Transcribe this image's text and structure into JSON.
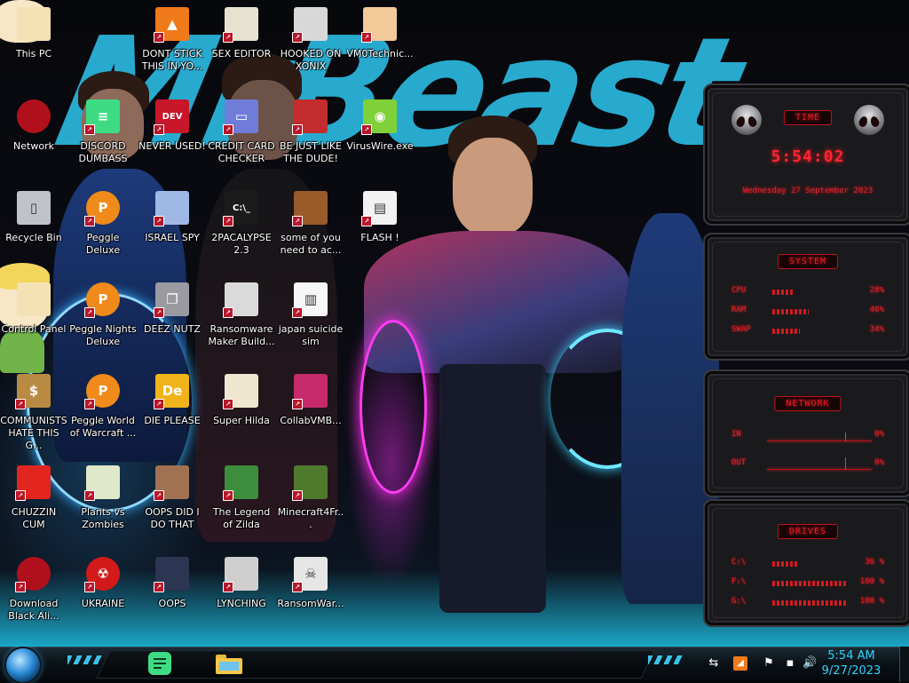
{
  "wallpaper": {
    "title_text": "MrBeast"
  },
  "desktop_icons": [
    {
      "label": "This PC",
      "icon": "star-vs-forces-icon"
    },
    {
      "label": "DONT STICK THIS IN YO...",
      "icon": "vlc-cone-icon"
    },
    {
      "label": "SEX EDITOR",
      "icon": "hex-editor-icon"
    },
    {
      "label": "HOOKED ON XONIX",
      "icon": "xonix-game-icon"
    },
    {
      "label": "VM0Technic...",
      "icon": "doctor-icon"
    },
    {
      "label": "Network",
      "icon": "red-orb-icon"
    },
    {
      "label": "DISCORD DUMBASS",
      "icon": "chat-app-icon"
    },
    {
      "label": "NEVER USED!",
      "icon": "devcpp-icon"
    },
    {
      "label": "CREDIT CARD CHECKER",
      "icon": "credit-card-icon"
    },
    {
      "label": "BE JUST LIKE THE DUDE!",
      "icon": "santa-icon"
    },
    {
      "label": "VirusWire.exe",
      "icon": "lime-icon"
    },
    {
      "label": "Recycle Bin",
      "icon": "trash-can-icon"
    },
    {
      "label": "Peggle Deluxe",
      "icon": "peggle-icon"
    },
    {
      "label": "ISRAEL SPY",
      "icon": "network-cable-icon"
    },
    {
      "label": "2PACALYPSE 2.3",
      "icon": "terminal-icon"
    },
    {
      "label": "some of you need to ac...",
      "icon": "beaver-icon"
    },
    {
      "label": "FLASH !",
      "icon": "document-icon"
    },
    {
      "label": "Control Panel",
      "icon": "star-vs-forces-icon"
    },
    {
      "label": "Peggle Nights Deluxe",
      "icon": "peggle-icon"
    },
    {
      "label": "DEEZ NUTZ",
      "icon": "windows-stack-icon"
    },
    {
      "label": "Ransomware Maker Build...",
      "icon": "window-app-icon"
    },
    {
      "label": "japan suicide sim",
      "icon": "file-icon"
    },
    {
      "label": "COMMUNISTS HATE THIS G...",
      "icon": "money-bag-icon"
    },
    {
      "label": "Peggle World of Warcraft ...",
      "icon": "peggle-icon"
    },
    {
      "label": "DIE PLEASE",
      "icon": "de-icon"
    },
    {
      "label": "Super Hilda",
      "icon": "pixel-game-icon"
    },
    {
      "label": "CollabVMB...",
      "icon": "pc-monitor-icon"
    },
    {
      "label": "CHUZZIN CUM",
      "icon": "chuzzle-icon"
    },
    {
      "label": "Plants vs Zombies",
      "icon": "pvz-icon"
    },
    {
      "label": "OOPS DID I DO THAT",
      "icon": "portrait-icon"
    },
    {
      "label": "The Legend of Zilda",
      "icon": "link-sprite-icon"
    },
    {
      "label": "Minecraft4Fr...",
      "icon": "grass-block-icon"
    },
    {
      "label": "Download Black Ali...",
      "icon": "red-orb-icon"
    },
    {
      "label": "UKRAINE",
      "icon": "radiation-icon"
    },
    {
      "label": "OOPS",
      "icon": "book-icon"
    },
    {
      "label": "LYNCHING",
      "icon": "rope-icon"
    },
    {
      "label": "RansomWar...",
      "icon": "skull-icon"
    }
  ],
  "gadgets": {
    "time": {
      "title": "TIME",
      "clock": "5:54:02",
      "date": "Wednesday 27 September 2023"
    },
    "system": {
      "title": "SYSTEM",
      "rows": [
        {
          "label": "CPU",
          "value": "28%",
          "level": 0.28
        },
        {
          "label": "RAM",
          "value": "46%",
          "level": 0.46
        },
        {
          "label": "SWAP",
          "value": "34%",
          "level": 0.34
        }
      ]
    },
    "network": {
      "title": "NETWORK",
      "rows": [
        {
          "label": "IN",
          "value": "0%"
        },
        {
          "label": "OUT",
          "value": "0%"
        }
      ]
    },
    "drives": {
      "title": "DRIVES",
      "rows": [
        {
          "label": "C:\\",
          "value": "36 %",
          "level": 0.36
        },
        {
          "label": "F:\\",
          "value": "100 %",
          "level": 1.0
        },
        {
          "label": "G:\\",
          "value": "100 %",
          "level": 1.0
        }
      ]
    }
  },
  "taskbar": {
    "apps": [
      {
        "name": "chat-app",
        "color": "#3ddc84"
      },
      {
        "name": "file-explorer",
        "color": "#f2c84b"
      }
    ],
    "clock_time": "5:54 AM",
    "clock_date": "9/27/2023"
  }
}
